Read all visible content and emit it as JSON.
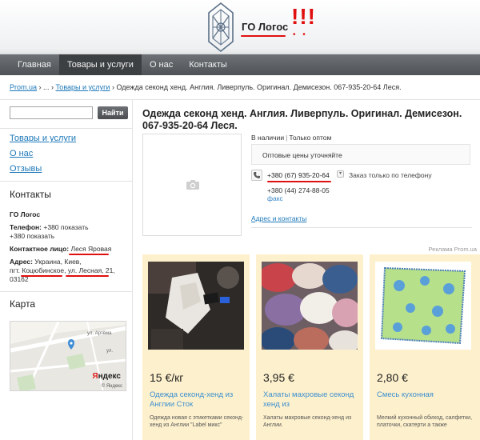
{
  "header": {
    "company": "ГО Логос",
    "exclaim": "!!!",
    "dots": "• •"
  },
  "nav": {
    "items": [
      {
        "label": "Главная"
      },
      {
        "label": "Товары и услуги"
      },
      {
        "label": "О нас"
      },
      {
        "label": "Контакты"
      }
    ]
  },
  "breadcrumb": {
    "root": "Prom.ua",
    "sep1": " › ... › ",
    "section": "Товары и услуги",
    "sep2": " › ",
    "current": "Одежда секонд хенд. Англия. Ливерпуль. Оригинал. Демисезон. 067-935-20-64 Леся."
  },
  "sidebar": {
    "search_placeholder": "",
    "search_button": "Найти",
    "links": [
      "Товары и услуги",
      "О нас",
      "Отзывы"
    ],
    "contacts_title": "Контакты",
    "company": "ГО Логос",
    "phone_label": "Телефон:",
    "phone_value1": "+380 показать",
    "phone_value2": "+380 показать",
    "person_label": "Контактное лицо:",
    "person_value": "Леся Яровая",
    "address_label": "Адрес:",
    "address_line1": "Украина, Киев,",
    "address_line2": "пгт. Коцюбинское, ул. Лесная, 21,",
    "address_line3": "03162",
    "map_title": "Карта",
    "map_street": "ул. Артёма",
    "map_street2": "ул.",
    "yandex_y": "Я",
    "yandex_rest": "ндекс",
    "map_copyright": "© Яндекс"
  },
  "product": {
    "title": "Одежда секонд хенд. Англия. Ливерпуль. Оригинал. Демисезон. 067-935-20-64 Леся.",
    "in_stock": "В наличии",
    "wholesale": "Только оптом",
    "price_note": "Оптовые цены уточняйте",
    "phone_main": "+380 (67) 935-20-64",
    "phone_chev": "▾",
    "phone_note": "Заказ только по телефону",
    "phone_second": "+380 (44) 274-88-05",
    "fax": "факс",
    "address_link": "Адрес и контакты"
  },
  "ads": {
    "label": "Реклама Prom.ua",
    "cards": [
      {
        "price": "15 €/кг",
        "name": "Одежда секонд-хенд из Англии Сток",
        "desc": "Одежда новая с этикетками секонд-хенд из Англии \"Label микс\""
      },
      {
        "price": "3,95 €",
        "name": "Халаты махровые секонд хенд из",
        "desc": "Халаты махровые секонд-хенд из Англии."
      },
      {
        "price": "2,80 €",
        "name": "Смесь кухонная",
        "desc": "Мелкий кухонный обиход, салфетки, платочки, скатерти а также"
      }
    ]
  },
  "colors": {
    "accent_link": "#1d78b8",
    "nav_bg": "#5a5e62",
    "card_bg": "#fdf0cc",
    "annotation_red": "#e01010"
  }
}
